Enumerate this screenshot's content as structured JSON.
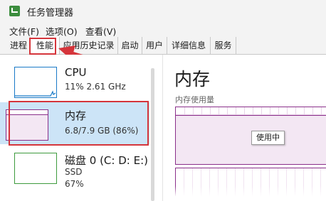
{
  "window": {
    "title": "任务管理器"
  },
  "menu": [
    "文件(F)",
    "选项(O)",
    "查看(V)"
  ],
  "tabs": [
    "进程",
    "性能",
    "应用历史记录",
    "启动",
    "用户",
    "详细信息",
    "服务"
  ],
  "active_tab": "性能",
  "sidebar": {
    "items": [
      {
        "title": "CPU",
        "sub1": "11% 2.61 GHz",
        "sub2": "",
        "color": "#1a7ac7"
      },
      {
        "title": "内存",
        "sub1": "6.8/7.9 GB (86%)",
        "sub2": "",
        "color": "#8a2f8a",
        "level": 0.86
      },
      {
        "title": "磁盘 0 (C: D: E:)",
        "sub1": "SSD",
        "sub2": "67%",
        "color": "#3e9b3e"
      }
    ]
  },
  "main": {
    "title": "内存",
    "chart_label": "内存使用量",
    "tooltip": "使用中",
    "usage_fraction": 0.86
  },
  "colors": {
    "highlight": "#d5353b",
    "memory": "#8a2f8a",
    "cpu": "#1a7ac7",
    "disk": "#3e9b3e",
    "selected_bg": "#cce4f7"
  }
}
